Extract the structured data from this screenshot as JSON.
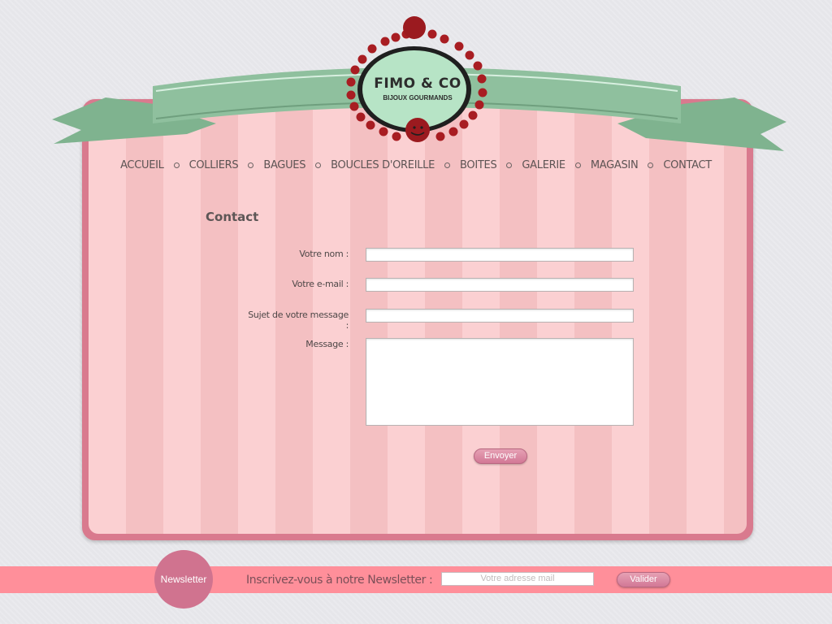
{
  "logo": {
    "title": "FIMO & CO",
    "subtitle": "BIJOUX GOURMANDS"
  },
  "nav": {
    "items": [
      "ACCUEIL",
      "COLLIERS",
      "BAGUES",
      "BOUCLES D'OREILLE",
      "BOITES",
      "GALERIE",
      "MAGASIN",
      "CONTACT"
    ]
  },
  "page": {
    "title": "Contact"
  },
  "form": {
    "name_label": "Votre nom :",
    "email_label": "Votre e-mail :",
    "subject_label": "Sujet de votre message :",
    "message_label": "Message :",
    "submit_label": "Envoyer"
  },
  "newsletter": {
    "badge": "Newsletter",
    "label": "Inscrivez-vous à notre Newsletter :",
    "placeholder": "Votre adresse mail",
    "submit_label": "Valider"
  },
  "colors": {
    "pink": "#fbd0d2",
    "accent": "#d0738f",
    "ribbon": "#8fc09e",
    "bead": "#a81d22"
  }
}
